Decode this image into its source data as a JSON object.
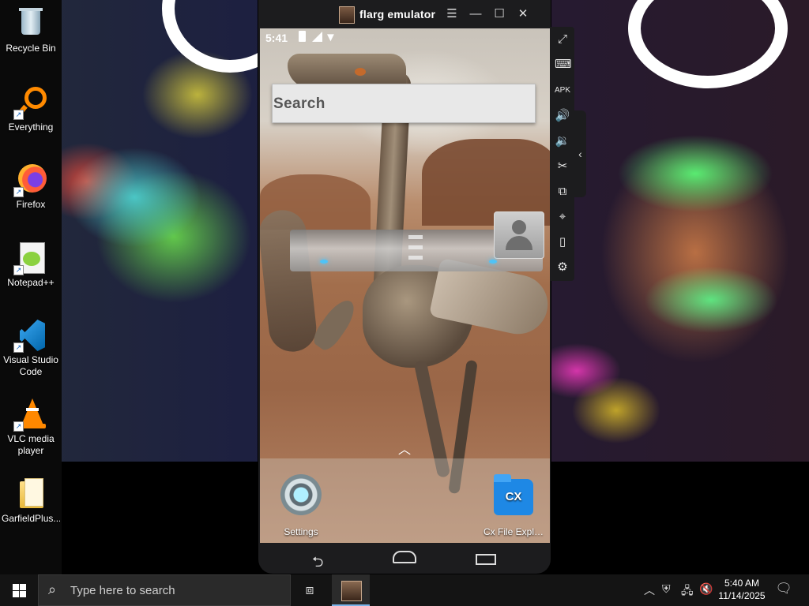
{
  "desktop": {
    "icons": [
      {
        "label": "Recycle Bin",
        "icon": "recycle-bin-icon"
      },
      {
        "label": "Everything",
        "icon": "magnifier-icon"
      },
      {
        "label": "Firefox",
        "icon": "firefox-icon"
      },
      {
        "label": "Notepad++",
        "icon": "notepad-plus-plus-icon"
      },
      {
        "label": "Visual Studio Code",
        "icon": "vscode-icon"
      },
      {
        "label": "VLC media player",
        "icon": "vlc-icon"
      },
      {
        "label": "GarfieldPlus...",
        "icon": "folder-icon"
      }
    ]
  },
  "emulator": {
    "title": "flarg emulator",
    "title_buttons": [
      "menu",
      "minimize",
      "maximize",
      "close"
    ],
    "status_time": "5:41",
    "search_label": "Search",
    "apps": [
      {
        "label": "Settings",
        "icon": "settings-gear-icon"
      },
      {
        "label": "Cx File Expl…",
        "icon": "cx-file-explorer-icon",
        "badge": "CX"
      }
    ],
    "side_tools": [
      "fullscreen",
      "keyboard",
      "apk-install",
      "volume-up",
      "volume-down",
      "screenshot-cut",
      "multi-instance",
      "location",
      "shake",
      "settings"
    ]
  },
  "taskbar": {
    "search_placeholder": "Type here to search",
    "time": "5:40 AM",
    "date": "11/14/2025"
  },
  "colors": {
    "taskbar_bg": "#141414",
    "emulator_frame": "#1c1c1e",
    "accent": "#7ab3e8"
  }
}
